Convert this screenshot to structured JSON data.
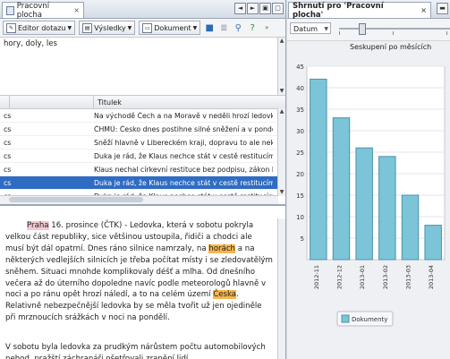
{
  "left_tab": {
    "label": "Pracovní plocha",
    "close": "×"
  },
  "left_tab_controls": [
    "◄",
    "►",
    "▣",
    "▢"
  ],
  "toolbar": {
    "query_editor": "Editor dotazu",
    "results": "Výsledky",
    "document": "Dokument"
  },
  "query": {
    "text": "hory, doly, les"
  },
  "results_table": {
    "columns": [
      "",
      "",
      "Titulek"
    ],
    "rows": [
      {
        "src": "cs",
        "title": "Na východě Čech a na Moravě v neděli hrozí ledovka",
        "selected": false
      },
      {
        "src": "cs",
        "title": "ČHMÚ: Česko dnes postihne silné sněžení a v pondělí",
        "selected": false
      },
      {
        "src": "cs",
        "title": "Sněží hlavně v Libereckém kraji, dopravu to ale nekomplikuje",
        "selected": false
      },
      {
        "src": "cs",
        "title": "Duka je rád, že Klaus nechce stát v cestě restitucím",
        "selected": false
      },
      {
        "src": "cs",
        "title": "Klaus nechal církevní restituce bez podpisu, zákon b",
        "selected": false
      },
      {
        "src": "cs",
        "title": "Duka je rád, že Klaus nechce stát v cestě restitucím",
        "selected": true
      },
      {
        "src": "cs",
        "title": "Duka je rád, že Klaus nechce stát v cestě restitucím",
        "selected": false
      }
    ]
  },
  "doc": {
    "p1_a": "Praha",
    "p1_b": " 16. prosince (ČTK) - Ledovka, která v sobotu pokryla velkou část republiky, sice většinou ustoupila, řidiči a chodci ale musí být dál opatrní. Dnes ráno silnice namrzaly, na ",
    "p1_c": "horách",
    "p1_d": " a na některých vedlejších silnicích je třeba počítat místy i se zledovatělým sněhem. Situaci mnohde komplikovaly déšť a mlha. Od dnešního večera až do úterního dopoledne navíc podle meteorologů hlavně v noci a po ránu opět hrozí náledí, a to na celém území ",
    "p1_e": "Česka",
    "p1_f": ". Relativně nebezpečnější ledovka by se měla tvořit už jen ojediněle při mrznoucích srážkách v noci na pondělí.",
    "p2": "V sobotu byla ledovka za prudkým nárůstem počtu automobilových nehod, pražští záchranáři ošetřovali zranění lidí"
  },
  "right_tab": {
    "label": "Shrnutí pro 'Pracovní plocha'",
    "close": "×"
  },
  "right_toolbar": {
    "combo": "Datum"
  },
  "colors": {
    "bar": "#7cc4d8",
    "bar_edge": "#4b93ab",
    "selection": "#2f6cc3"
  },
  "chart_data": {
    "type": "bar",
    "title": "Seskupení po měsících",
    "categories": [
      "2012-11",
      "2012-12",
      "2013-01",
      "2013-02",
      "2013-03",
      "2013-04"
    ],
    "values": [
      42,
      33,
      26,
      24,
      15,
      8
    ],
    "ylim": [
      0,
      45
    ],
    "yticks": [
      5,
      10,
      15,
      20,
      25,
      30,
      35,
      40,
      45
    ],
    "grid": true,
    "legend": {
      "label": "Dokumenty",
      "position": "bottom"
    }
  }
}
